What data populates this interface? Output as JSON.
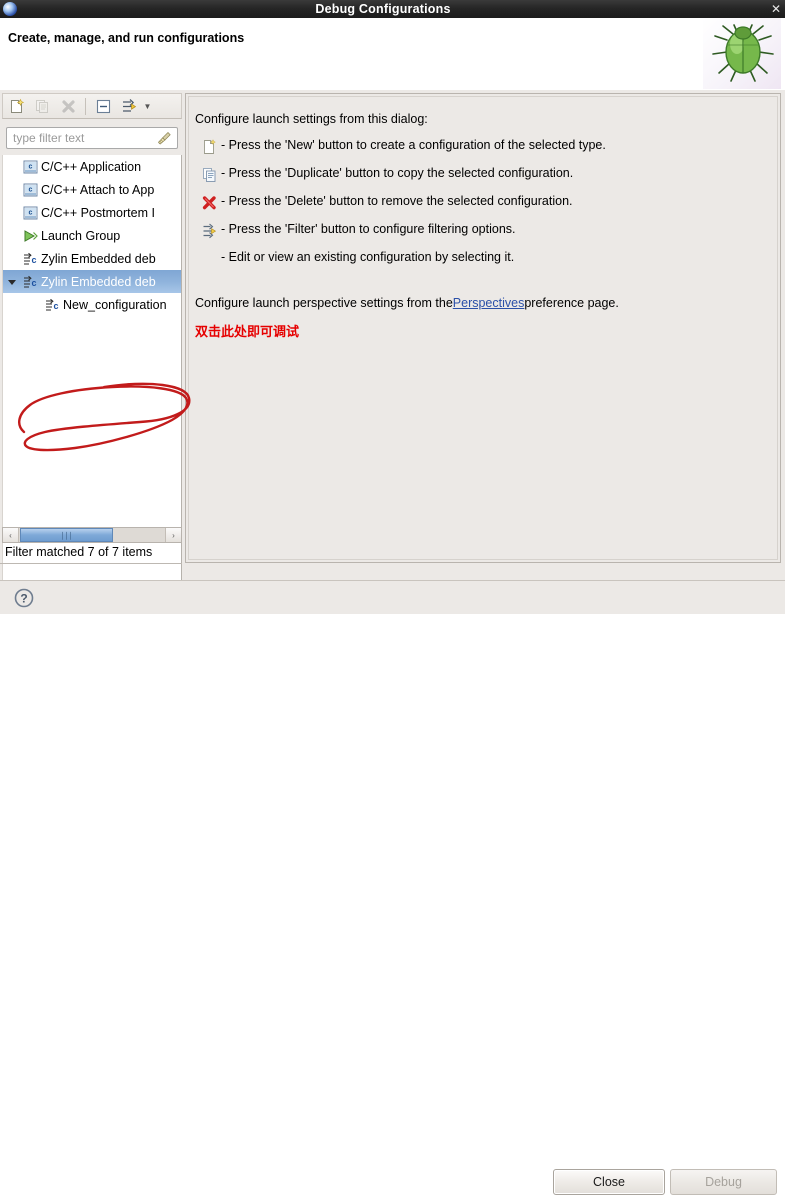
{
  "window": {
    "title": "Debug Configurations",
    "app_icon": "eclipse-icon",
    "close_label": "✕"
  },
  "header": {
    "title": "Create, manage, and run configurations",
    "image": "green-bug-icon"
  },
  "toolbar": {
    "buttons": [
      {
        "name": "new-launch-configuration-button",
        "icon": "new-document-icon",
        "enabled": true
      },
      {
        "name": "duplicate-launch-configuration-button",
        "icon": "duplicate-icon",
        "enabled": false
      },
      {
        "name": "delete-launch-configuration-button",
        "icon": "delete-x-icon",
        "enabled": false
      },
      {
        "name": "collapse-all-button",
        "icon": "collapse-all-icon",
        "enabled": true
      },
      {
        "name": "filter-launch-configurations-button",
        "icon": "filter-icon",
        "enabled": true
      }
    ]
  },
  "filter": {
    "placeholder": "type filter text",
    "value": "",
    "clear_icon": "broom-icon",
    "status": "Filter matched 7 of 7 items"
  },
  "tree": {
    "items": [
      {
        "label": "C/C++ Application",
        "icon": "c-cpp-icon",
        "indent": 0,
        "selected": false,
        "twisty": ""
      },
      {
        "label": "C/C++ Attach to App",
        "icon": "c-cpp-icon",
        "indent": 0,
        "selected": false,
        "twisty": ""
      },
      {
        "label": "C/C++ Postmortem I",
        "icon": "c-cpp-icon",
        "indent": 0,
        "selected": false,
        "twisty": ""
      },
      {
        "label": "Launch Group",
        "icon": "launch-group-icon",
        "indent": 0,
        "selected": false,
        "twisty": ""
      },
      {
        "label": "Zylin Embedded deb",
        "icon": "zylin-icon",
        "indent": 0,
        "selected": false,
        "twisty": ""
      },
      {
        "label": "Zylin Embedded deb",
        "icon": "zylin-icon",
        "indent": 0,
        "selected": true,
        "twisty": "▼"
      },
      {
        "label": "New_configuration",
        "icon": "zylin-icon",
        "indent": 1,
        "selected": false,
        "twisty": ""
      }
    ]
  },
  "scrollbar": {
    "left_arrow": "‹",
    "right_arrow": "›",
    "grip": "∣∣∣"
  },
  "panel": {
    "intro": "Configure launch settings from this dialog:",
    "items": [
      {
        "icon": "new-document-icon",
        "text": "- Press the 'New' button to create a configuration of the selected type."
      },
      {
        "icon": "duplicate-icon",
        "text": "- Press the 'Duplicate' button to copy the selected configuration."
      },
      {
        "icon": "delete-x-icon",
        "text": "- Press the 'Delete' button to remove the selected configuration."
      },
      {
        "icon": "filter-icon",
        "text": "- Press the 'Filter' button to configure filtering options."
      },
      {
        "icon": "none",
        "text": "- Edit or view an existing configuration by selecting it."
      }
    ],
    "perspective_prefix": "Configure launch perspective settings from the ",
    "perspective_link": "Perspectives",
    "perspective_suffix": " preference page.",
    "annotation_note": "双击此处即可调试"
  },
  "footer": {
    "help_icon": "help-question-icon",
    "close_label": "Close",
    "debug_label": "Debug"
  },
  "colors": {
    "selection_blue": "#8fb3dc",
    "link_blue": "#2b50a8",
    "annotation_red": "#e60000",
    "panel_bg": "#ece9e6",
    "titlebar_bg": "#262626"
  }
}
